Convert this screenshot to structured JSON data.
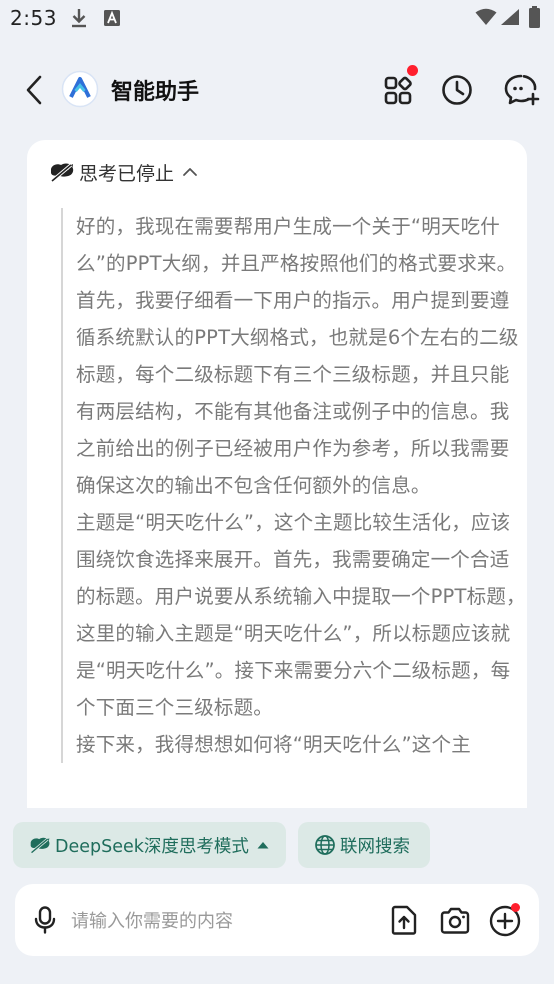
{
  "status_bar": {
    "time": "2:53",
    "icons": [
      "download-icon",
      "a-notification-icon",
      "wifi-icon",
      "signal-icon",
      "battery-icon"
    ]
  },
  "header": {
    "title": "智能助手",
    "icons": [
      "back-icon",
      "app-logo",
      "apps-icon",
      "history-icon",
      "new-chat-icon"
    ]
  },
  "thinking": {
    "label": "思考已停止",
    "paragraphs": [
      "好的，我现在需要帮用户生成一个关于“明天吃什么”的PPT大纲，并且严格按照他们的格式要求来。首先，我要仔细看一下用户的指示。用户提到要遵循系统默认的PPT大纲格式，也就是6个左右的二级标题，每个二级标题下有三个三级标题，并且只能有两层结构，不能有其他备注或例子中的信息。我之前给出的例子已经被用户作为参考，所以我需要确保这次的输出不包含任何额外的信息。",
      "主题是“明天吃什么”，这个主题比较生活化，应该围绕饮食选择来展开。首先，我需要确定一个合适的标题。用户说要从系统输入中提取一个PPT标题，这里的输入主题是“明天吃什么”，所以标题应该就是“明天吃什么”。接下来需要分六个二级标题，每个下面三个三级标题。",
      "接下来，我得想想如何将“明天吃什么”这个主"
    ]
  },
  "modes": {
    "deepseek_label": "DeepSeek深度思考模式",
    "web_search_label": "联网搜索"
  },
  "input": {
    "placeholder": "请输入你需要的内容",
    "value": ""
  },
  "colors": {
    "background": "#eef1f6",
    "chip_background": "#dce9e6",
    "chip_text": "#1f6d5c",
    "badge": "#ff1f2d",
    "logo": "#2e6fd8"
  }
}
